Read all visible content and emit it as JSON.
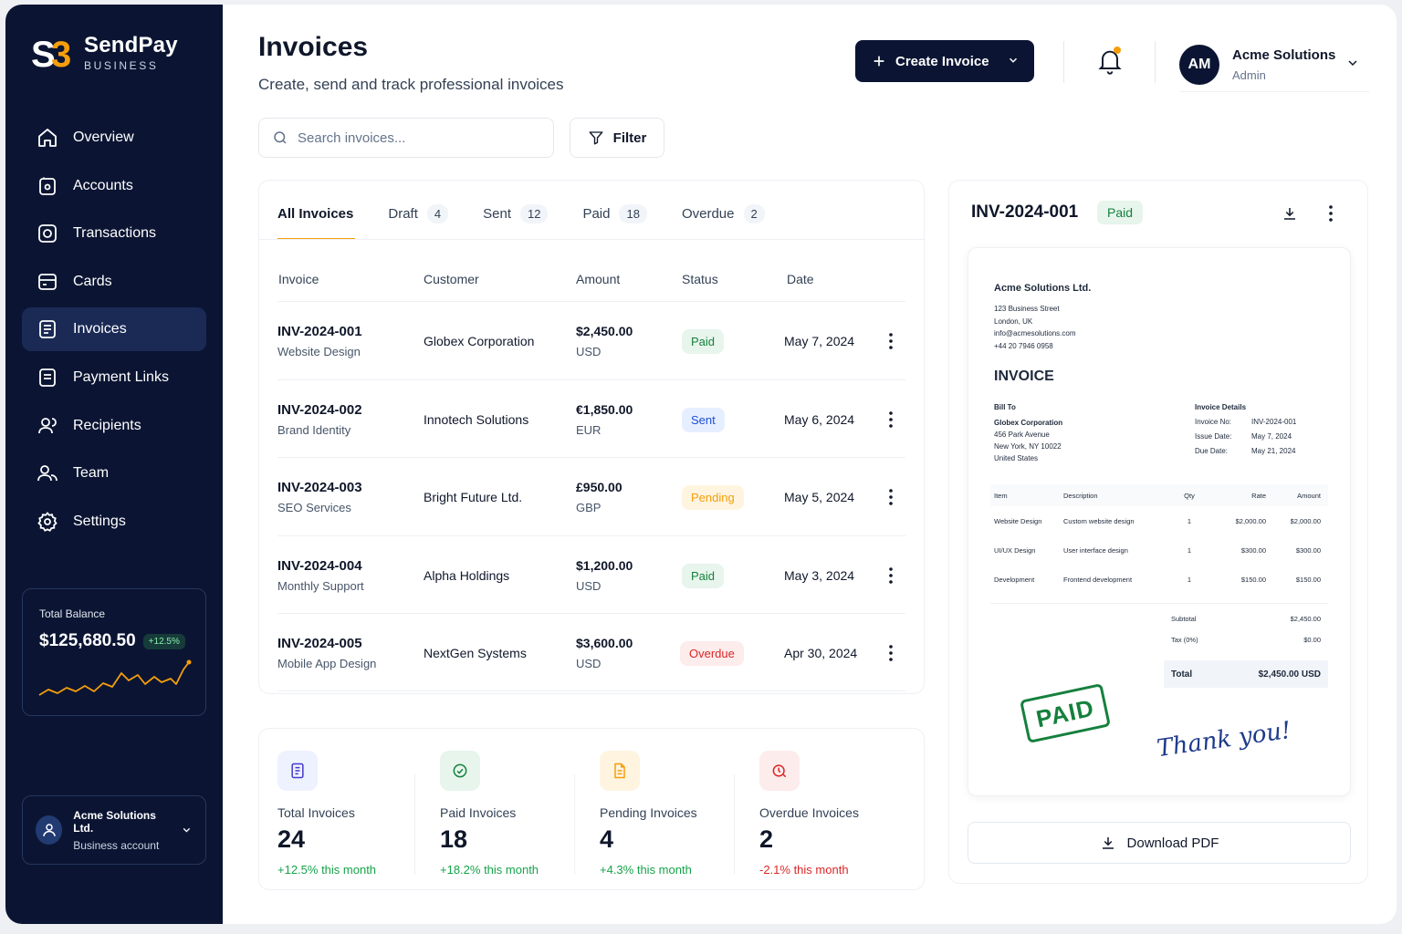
{
  "brand": {
    "name": "SendPay",
    "sub": "BUSINESS",
    "mark": "S3"
  },
  "nav": [
    {
      "label": "Overview",
      "icon": "home-icon"
    },
    {
      "label": "Accounts",
      "icon": "wallet-icon"
    },
    {
      "label": "Transactions",
      "icon": "transactions-icon"
    },
    {
      "label": "Cards",
      "icon": "card-icon"
    },
    {
      "label": "Invoices",
      "icon": "invoice-icon",
      "active": true
    },
    {
      "label": "Payment Links",
      "icon": "link-doc-icon"
    },
    {
      "label": "Recipients",
      "icon": "users-icon"
    },
    {
      "label": "Team",
      "icon": "team-icon"
    },
    {
      "label": "Settings",
      "icon": "gear-icon"
    }
  ],
  "balance": {
    "label": "Total Balance",
    "value": "$125,680.50",
    "change": "+12.5%"
  },
  "account": {
    "name": "Acme Solutions Ltd.",
    "type": "Business account"
  },
  "header": {
    "title": "Invoices",
    "subtitle": "Create, send and track professional invoices",
    "create_label": "Create Invoice",
    "user": {
      "initials": "AM",
      "name": "Acme Solutions",
      "role": "Admin"
    }
  },
  "search": {
    "placeholder": "Search invoices..."
  },
  "filter_label": "Filter",
  "tabs": [
    {
      "label": "All Invoices",
      "count": ""
    },
    {
      "label": "Draft",
      "count": "4"
    },
    {
      "label": "Sent",
      "count": "12"
    },
    {
      "label": "Paid",
      "count": "18"
    },
    {
      "label": "Overdue",
      "count": "2"
    }
  ],
  "columns": [
    "Invoice",
    "Customer",
    "Amount",
    "Status",
    "Date"
  ],
  "invoices": [
    {
      "id": "INV-2024-001",
      "desc": "Website Design",
      "customer": "Globex Corporation",
      "amount": "$2,450.00",
      "currency": "USD",
      "status": "Paid",
      "status_key": "paid",
      "date": "May 7, 2024"
    },
    {
      "id": "INV-2024-002",
      "desc": "Brand Identity",
      "customer": "Innotech Solutions",
      "amount": "€1,850.00",
      "currency": "EUR",
      "status": "Sent",
      "status_key": "sent",
      "date": "May 6, 2024"
    },
    {
      "id": "INV-2024-003",
      "desc": "SEO Services",
      "customer": "Bright Future Ltd.",
      "amount": "£950.00",
      "currency": "GBP",
      "status": "Pending",
      "status_key": "pending",
      "date": "May 5, 2024"
    },
    {
      "id": "INV-2024-004",
      "desc": "Monthly Support",
      "customer": "Alpha Holdings",
      "amount": "$1,200.00",
      "currency": "USD",
      "status": "Paid",
      "status_key": "paid",
      "date": "May 3, 2024"
    },
    {
      "id": "INV-2024-005",
      "desc": "Mobile App Design",
      "customer": "NextGen Systems",
      "amount": "$3,600.00",
      "currency": "USD",
      "status": "Overdue",
      "status_key": "overdue",
      "date": "Apr 30, 2024"
    }
  ],
  "stats": [
    {
      "label": "Total Invoices",
      "value": "24",
      "change": "+12.5% this month",
      "color": "#16a34a",
      "icon": "document-icon",
      "icon_bg": "#eef2ff",
      "icon_color": "#4338ca"
    },
    {
      "label": "Paid Invoices",
      "value": "18",
      "change": "+18.2% this month",
      "color": "#16a34a",
      "icon": "check-circle-icon",
      "icon_bg": "#e7f5ec",
      "icon_color": "#15803d"
    },
    {
      "label": "Pending Invoices",
      "value": "4",
      "change": "+4.3% this month",
      "color": "#16a34a",
      "icon": "pending-doc-icon",
      "icon_bg": "#fff4e0",
      "icon_color": "#f59e0b"
    },
    {
      "label": "Overdue Invoices",
      "value": "2",
      "change": "-2.1% this month",
      "color": "#dc2626",
      "icon": "overdue-clock-icon",
      "icon_bg": "#fdecec",
      "icon_color": "#dc2626"
    }
  ],
  "preview": {
    "id": "INV-2024-001",
    "status": "Paid",
    "download_label": "Download PDF",
    "doc": {
      "company": "Acme Solutions Ltd.",
      "address": [
        "123 Business Street",
        "London, UK",
        "info@acmesolutions.com",
        "+44 20 7946 0958"
      ],
      "heading": "INVOICE",
      "bill_to_label": "Bill To",
      "bill_to": [
        "Globex Corporation",
        "456 Park Avenue",
        "New York, NY 10022",
        "United States"
      ],
      "details_label": "Invoice Details",
      "details": [
        {
          "k": "Invoice No:",
          "v": "INV-2024-001"
        },
        {
          "k": "Issue Date:",
          "v": "May 7, 2024"
        },
        {
          "k": "Due Date:",
          "v": "May 21, 2024"
        }
      ],
      "columns": [
        "Item",
        "Description",
        "Qty",
        "Rate",
        "Amount"
      ],
      "items": [
        {
          "item": "Website Design",
          "desc": "Custom website design",
          "qty": "1",
          "rate": "$2,000.00",
          "amount": "$2,000.00"
        },
        {
          "item": "UI/UX Design",
          "desc": "User interface design",
          "qty": "1",
          "rate": "$300.00",
          "amount": "$300.00"
        },
        {
          "item": "Development",
          "desc": "Frontend development",
          "qty": "1",
          "rate": "$150.00",
          "amount": "$150.00"
        }
      ],
      "subtotal_label": "Subtotal",
      "subtotal": "$2,450.00",
      "tax_label": "Tax (0%)",
      "tax": "$0.00",
      "total_label": "Total",
      "total": "$2,450.00 USD",
      "stamp": "PAID",
      "signature": "Thank you!"
    }
  }
}
